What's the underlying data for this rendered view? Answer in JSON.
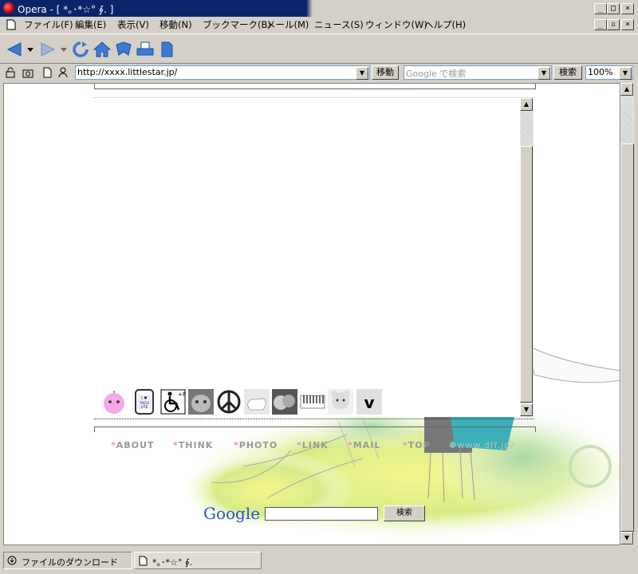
{
  "window": {
    "title": "Opera - [ *｡･*☆° ∮. ]",
    "controls": [
      "_",
      "□",
      "×"
    ]
  },
  "menu": {
    "items": [
      "ファイル(F)",
      "編集(E)",
      "表示(V)",
      "移動(N)",
      "ブックマーク(B)",
      "メール(M)",
      "ニュース(S)",
      "ウィンドウ(W)",
      "ヘルプ(H)"
    ]
  },
  "toolbar": {
    "icons": [
      "back-icon",
      "forward-icon",
      "reload-icon",
      "home-icon",
      "hotlist-icon",
      "print-icon",
      "document-icon"
    ]
  },
  "address": {
    "url": "http://xxxx.littlestar.jp/",
    "go_label": "移動",
    "search_placeholder": "Google で検索",
    "search_button": "検索",
    "zoom": "100%"
  },
  "page": {
    "nav": [
      "ABOUT",
      "THINK",
      "PHOTO",
      "LINK",
      "MAIL",
      "TOP"
    ],
    "credit": "www.dff.jp/",
    "star": "*",
    "google_logo": "Google",
    "search_button": "検索",
    "icon_v_label": "v",
    "icon_tag_label": "I ♥ TAGU UTE"
  },
  "status": {
    "download_tab": "ファイルのダウンロード",
    "page_tab": "*｡･*☆° ∮."
  }
}
